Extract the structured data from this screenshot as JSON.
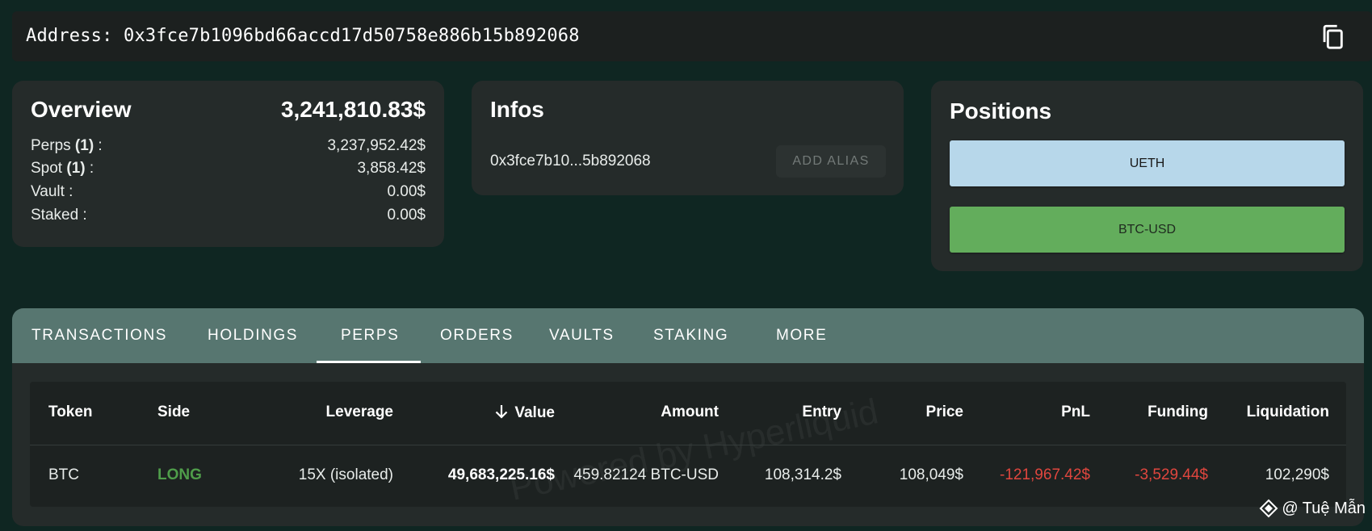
{
  "address_bar": {
    "text": "Address: 0x3fce7b1096bd66accd17d50758e886b15b892068",
    "copy_icon": "copy-icon"
  },
  "overview": {
    "title": "Overview",
    "total": "3,241,810.83$",
    "rows": [
      {
        "label": "Perps",
        "count": "(1)",
        "suffix": " :",
        "value": "3,237,952.42$"
      },
      {
        "label": "Spot",
        "count": "(1)",
        "suffix": " :",
        "value": "3,858.42$"
      },
      {
        "label": "Vault :",
        "count": "",
        "suffix": "",
        "value": "0.00$"
      },
      {
        "label": "Staked :",
        "count": "",
        "suffix": "",
        "value": "0.00$"
      }
    ]
  },
  "infos": {
    "title": "Infos",
    "short_address": "0x3fce7b10...5b892068",
    "add_alias_label": "ADD ALIAS"
  },
  "positions": {
    "title": "Positions",
    "items": [
      {
        "label": "UETH",
        "color": "#b7d7ea"
      },
      {
        "label": "BTC-USD",
        "color": "#63ad5c"
      }
    ]
  },
  "tabs": {
    "items": [
      {
        "label": "TRANSACTIONS",
        "active": false
      },
      {
        "label": "HOLDINGS",
        "active": false
      },
      {
        "label": "PERPS",
        "active": true
      },
      {
        "label": "ORDERS",
        "active": false
      },
      {
        "label": "VAULTS",
        "active": false
      },
      {
        "label": "STAKING",
        "active": false
      },
      {
        "label": "MORE",
        "active": false
      }
    ]
  },
  "table": {
    "watermark": "Powered by Hyperliquid",
    "sort_icon": "arrow-down-icon",
    "headers": [
      "Token",
      "Side",
      "Leverage",
      "Value",
      "Amount",
      "Entry",
      "Price",
      "PnL",
      "Funding",
      "Liquidation"
    ],
    "rows": [
      {
        "token": "BTC",
        "side": "LONG",
        "leverage": "15X (isolated)",
        "value": "49,683,225.16$",
        "amount": "459.82124 BTC-USD",
        "entry": "108,314.2$",
        "price": "108,049$",
        "pnl": "-121,967.42$",
        "funding": "-3,529.44$",
        "liquidation": "102,290$"
      }
    ]
  },
  "colors": {
    "background": "#0f2622",
    "card": "#252b2a",
    "tab_bar": "#577670",
    "long": "#4f9d4a",
    "negative": "#e0463e"
  },
  "credit": {
    "icon": "diamond-logo-icon",
    "text": "@ Tuệ Mẫn"
  }
}
